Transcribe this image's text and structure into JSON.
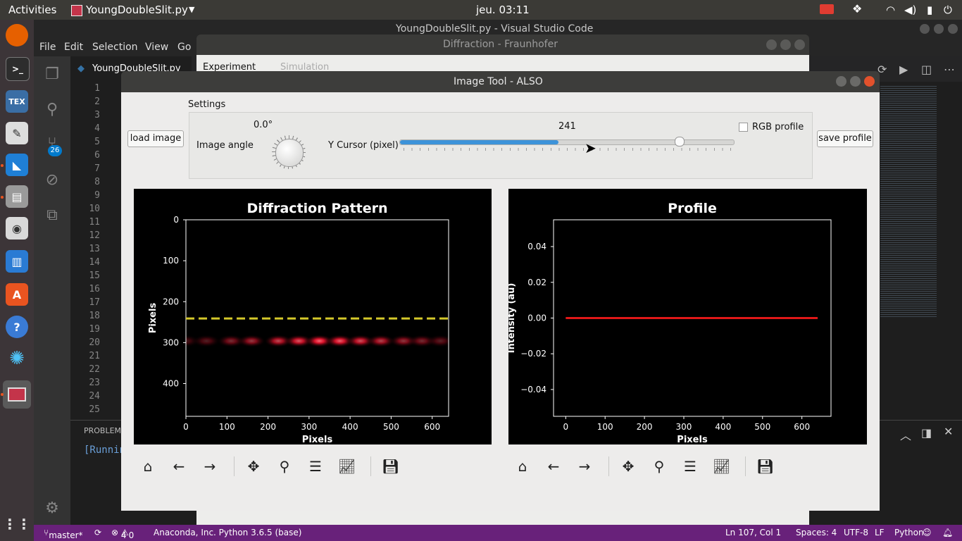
{
  "topbar": {
    "activities": "Activities",
    "app": "YoungDoubleSlit.py",
    "clock": "jeu. 03:11"
  },
  "dock": {
    "badge": "26",
    "tex": "TEX"
  },
  "vscode": {
    "title": "YoungDoubleSlit.py - Visual Studio Code",
    "menu": [
      "File",
      "Edit",
      "Selection",
      "View",
      "Go"
    ],
    "tab": "YoungDoubleSlit.py",
    "line_numbers": [
      "1",
      "2",
      "3",
      "4",
      "5",
      "6",
      "7",
      "8",
      "9",
      "10",
      "11",
      "12",
      "13",
      "14",
      "15",
      "16",
      "17",
      "18",
      "19",
      "20",
      "21",
      "22",
      "23",
      "24",
      "25"
    ],
    "panel_tab": "PROBLEMS",
    "terminal_text": "[Runnin",
    "status": {
      "branch": "master*",
      "errors": "4",
      "warnings": "0",
      "interpreter": "Anaconda, Inc. Python 3.6.5 (base)",
      "position": "Ln 107, Col 1",
      "spaces": "Spaces: 4",
      "encoding": "UTF-8",
      "eol": "LF",
      "language": "Python"
    }
  },
  "diffraction_window": {
    "title": "Diffraction - Fraunhofer",
    "tabs": [
      "Experiment",
      "Simulation"
    ]
  },
  "image_tool": {
    "title": "Image Tool - ALSO",
    "settings_label": "Settings",
    "load_button": "load image",
    "save_button": "save profile",
    "angle_label": "Image angle",
    "angle_value": "0.0°",
    "cursor_label": "Y Cursor (pixel)",
    "cursor_value": "241",
    "rgb_label": "RGB profile",
    "slider_fraction": 0.474
  },
  "chart_data": [
    {
      "type": "heatmap",
      "title": "Diffraction Pattern",
      "xlabel": "Pixels",
      "ylabel": "Pixels",
      "xlim": [
        0,
        640
      ],
      "ylim": [
        480,
        0
      ],
      "xticks": [
        "0",
        "100",
        "200",
        "300",
        "400",
        "500",
        "600"
      ],
      "yticks": [
        "0",
        "100",
        "200",
        "300",
        "400"
      ],
      "cursor_y": 241,
      "fringe_y": 296,
      "fringes_x": [
        0,
        50,
        110,
        160,
        225,
        275,
        325,
        375,
        425,
        475,
        530,
        575,
        620
      ]
    },
    {
      "type": "line",
      "title": "Profile",
      "xlabel": "Pixels",
      "ylabel": "Intensity (au)",
      "xlim": [
        -31,
        674
      ],
      "ylim": [
        -0.055,
        0.055
      ],
      "xticks": [
        "0",
        "100",
        "200",
        "300",
        "400",
        "500",
        "600"
      ],
      "yticks": [
        "0.04",
        "0.02",
        "0.00",
        "−0.02",
        "−0.04"
      ],
      "series": [
        {
          "x": [
            0,
            640
          ],
          "y": [
            0,
            0
          ]
        }
      ]
    }
  ]
}
